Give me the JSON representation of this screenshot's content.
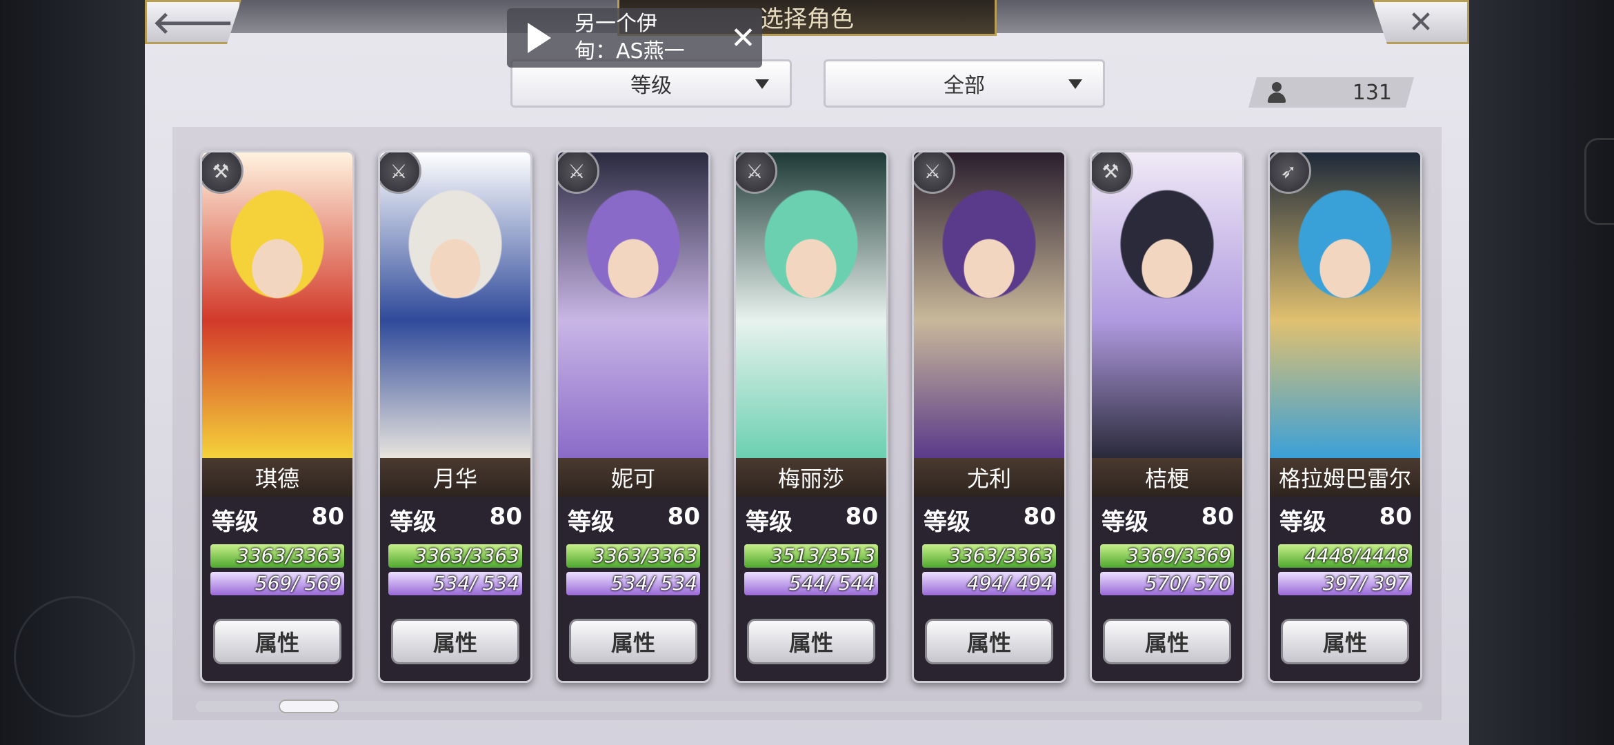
{
  "header": {
    "title": "选择角色",
    "back_glyph": "🡐",
    "close_glyph": "✕"
  },
  "overlay": {
    "line1": "另一个伊",
    "line2": "甸：AS燕一",
    "close_glyph": "✕"
  },
  "filters": {
    "sort_value": "等级",
    "category_value": "全部"
  },
  "roster_count": "131",
  "ui_labels": {
    "level_label": "等级",
    "attr_button": "属性"
  },
  "characters": [
    {
      "name": "琪德",
      "level": "80",
      "hp": "3363/3363",
      "mp": "569/ 569",
      "weapon_icon": "axe-icon",
      "palette": [
        "#f5d23a",
        "#d23a2a",
        "#fff3e0"
      ]
    },
    {
      "name": "月华",
      "level": "80",
      "hp": "3363/3363",
      "mp": "534/ 534",
      "weapon_icon": "sword-icon",
      "palette": [
        "#e8e4de",
        "#2f4a9a",
        "#ffffff"
      ]
    },
    {
      "name": "妮可",
      "level": "80",
      "hp": "3363/3363",
      "mp": "534/ 534",
      "weapon_icon": "sword-icon",
      "palette": [
        "#8a6ac8",
        "#c9b6e6",
        "#2a2a40"
      ]
    },
    {
      "name": "梅丽莎",
      "level": "80",
      "hp": "3513/3513",
      "mp": "544/ 544",
      "weapon_icon": "sword-icon",
      "palette": [
        "#6ad0b0",
        "#e8f2ee",
        "#1e3a36"
      ]
    },
    {
      "name": "尤利",
      "level": "80",
      "hp": "3363/3363",
      "mp": "494/ 494",
      "weapon_icon": "katana-icon",
      "palette": [
        "#5a3a8a",
        "#c8b89a",
        "#2a1e2e"
      ]
    },
    {
      "name": "桔梗",
      "level": "80",
      "hp": "3369/3369",
      "mp": "570/ 570",
      "weapon_icon": "axe-icon",
      "palette": [
        "#2a2a3a",
        "#b09ae0",
        "#f0eaf6"
      ]
    },
    {
      "name": "格拉姆巴雷尔",
      "level": "80",
      "hp": "4448/4448",
      "mp": "397/ 397",
      "weapon_icon": "spear-icon",
      "palette": [
        "#3aa0d8",
        "#e0c070",
        "#1e2a3a"
      ]
    }
  ]
}
